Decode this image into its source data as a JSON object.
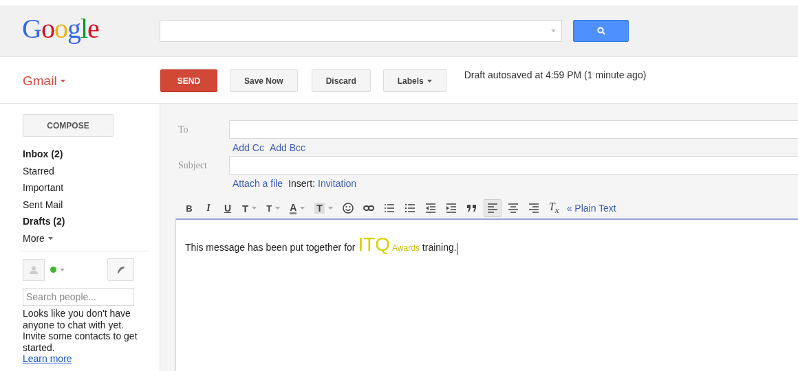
{
  "header": {
    "logo": "Google"
  },
  "app_bar": {
    "app_name": "Gmail",
    "buttons": [
      {
        "label": "SEND",
        "kind": "primary"
      },
      {
        "label": "Save Now",
        "kind": "plain"
      },
      {
        "label": "Discard",
        "kind": "plain"
      },
      {
        "label": "Labels",
        "kind": "menu"
      }
    ],
    "status": "Draft autosaved at 4:59 PM (1 minute ago)"
  },
  "sidebar": {
    "compose": "COMPOSE",
    "items": [
      {
        "label": "Inbox (2)",
        "bold": true,
        "menu": false
      },
      {
        "label": "Starred",
        "bold": false,
        "menu": false
      },
      {
        "label": "Important",
        "bold": false,
        "menu": false
      },
      {
        "label": "Sent Mail",
        "bold": false,
        "menu": false
      },
      {
        "label": "Drafts (2)",
        "bold": true,
        "menu": false
      },
      {
        "label": "More",
        "bold": false,
        "menu": true
      }
    ],
    "chat": {
      "online": true,
      "search_placeholder": "Search people...",
      "message": "Looks like you don't have anyone to chat with yet. Invite some contacts to get started.",
      "link": "Learn more"
    }
  },
  "compose": {
    "to_label": "To",
    "cc_links": [
      "Add Cc",
      "Add Bcc"
    ],
    "subject_label": "Subject",
    "attach_link": "Attach a file",
    "insert_label": "Insert:",
    "insert_link": "Invitation",
    "toolbar": [
      {
        "kind": "bold",
        "label": "B",
        "dropdown": false,
        "selected": false
      },
      {
        "kind": "italic",
        "label": "I",
        "dropdown": false,
        "selected": false
      },
      {
        "kind": "underline",
        "label": "U",
        "dropdown": false,
        "selected": false
      },
      {
        "kind": "font",
        "label": "T",
        "dropdown": true,
        "selected": false
      },
      {
        "kind": "size",
        "label": "T",
        "dropdown": true,
        "selected": false
      },
      {
        "kind": "color",
        "label": "A",
        "dropdown": true,
        "selected": false
      },
      {
        "kind": "bgcolor",
        "label": "T",
        "dropdown": true,
        "selected": false
      },
      {
        "kind": "emoji",
        "dropdown": false,
        "selected": false
      },
      {
        "kind": "link",
        "dropdown": false,
        "selected": false
      },
      {
        "kind": "numbered",
        "dropdown": false,
        "selected": false
      },
      {
        "kind": "bulleted",
        "dropdown": false,
        "selected": false
      },
      {
        "kind": "outdent",
        "dropdown": false,
        "selected": false
      },
      {
        "kind": "indent",
        "dropdown": false,
        "selected": false
      },
      {
        "kind": "quote",
        "dropdown": false,
        "selected": false
      },
      {
        "kind": "align-left",
        "dropdown": false,
        "selected": true
      },
      {
        "kind": "align-center",
        "dropdown": false,
        "selected": false
      },
      {
        "kind": "align-right",
        "dropdown": false,
        "selected": false
      },
      {
        "kind": "clear",
        "label": "T$_{x}$",
        "dropdown": false,
        "selected": false
      }
    ],
    "plain_text_link": "« Plain Text",
    "body": [
      {
        "text": "This message has been put together for ",
        "kind": "normal"
      },
      {
        "text": "ITQ",
        "kind": "large",
        "color": "#d8d000"
      },
      {
        "text": "Awards",
        "kind": "small",
        "color": "#c8c000"
      },
      {
        "text": "training.",
        "kind": "normal"
      }
    ]
  }
}
